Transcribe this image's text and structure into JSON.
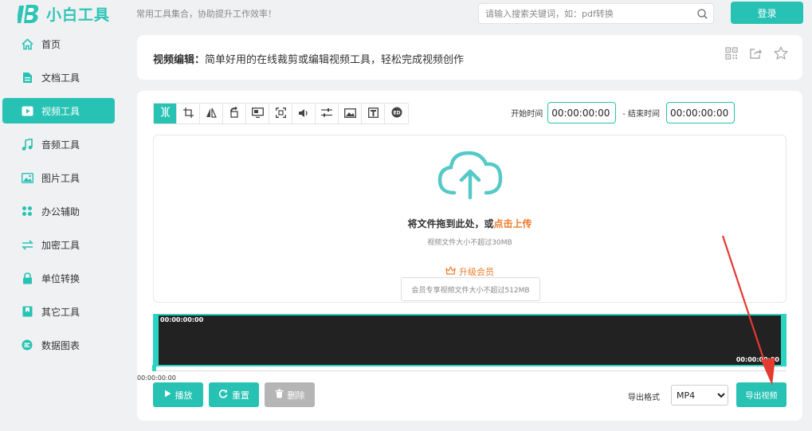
{
  "brand": {
    "logo_letter": "B",
    "name": "小白工具",
    "slogan": "常用工具集合，协助提升工作效率！"
  },
  "search": {
    "placeholder": "请输入搜索关键词，如：pdf转换"
  },
  "header": {
    "login_label": "登录"
  },
  "sidebar": {
    "items": [
      {
        "label": "首页",
        "icon": "home-icon"
      },
      {
        "label": "文档工具",
        "icon": "document-icon"
      },
      {
        "label": "视频工具",
        "icon": "video-icon",
        "active": true
      },
      {
        "label": "音频工具",
        "icon": "music-icon"
      },
      {
        "label": "图片工具",
        "icon": "image-icon"
      },
      {
        "label": "办公辅助",
        "icon": "office-icon"
      },
      {
        "label": "加密工具",
        "icon": "transfer-icon"
      },
      {
        "label": "单位转换",
        "icon": "lock-icon"
      },
      {
        "label": "其它工具",
        "icon": "bookmark-icon"
      },
      {
        "label": "数据图表",
        "icon": "chart-icon"
      }
    ]
  },
  "title": {
    "name": "视频编辑：",
    "desc": "简单好用的在线裁剪或编辑视频工具，轻松完成视频创作"
  },
  "editor": {
    "tools": [
      "trim-icon",
      "crop-icon",
      "flip-icon",
      "rotate-icon",
      "screen-icon",
      "capture-icon",
      "volume-icon",
      "adjust-icon",
      "picture-icon",
      "text-icon",
      "subtitle-icon"
    ],
    "start_label": "开始时间",
    "start_value": "00:00:00:00",
    "separator": "-",
    "end_label": "结束时间",
    "end_value": "00:00:00:00",
    "drop_text": "将文件拖到此处，或",
    "drop_link": "点击上传",
    "drop_limit": "视频文件大小不超过30MB",
    "vip_label": "升级会员",
    "vip_note": "会员专享视频文件大小不超过512MB",
    "timeline_start": "00:00:00:00",
    "timeline_end": "00:00:00:00",
    "cursor_time": "00:00:00:00",
    "play_label": "播放",
    "reset_label": "重置",
    "delete_label": "删除",
    "format_label": "导出格式",
    "format_value": "MP4",
    "export_label": "导出视频"
  },
  "colors": {
    "accent": "#27c2b4",
    "link": "#f07a2a",
    "disabled": "#b5b5b5",
    "annotation": "#e53a2f"
  }
}
